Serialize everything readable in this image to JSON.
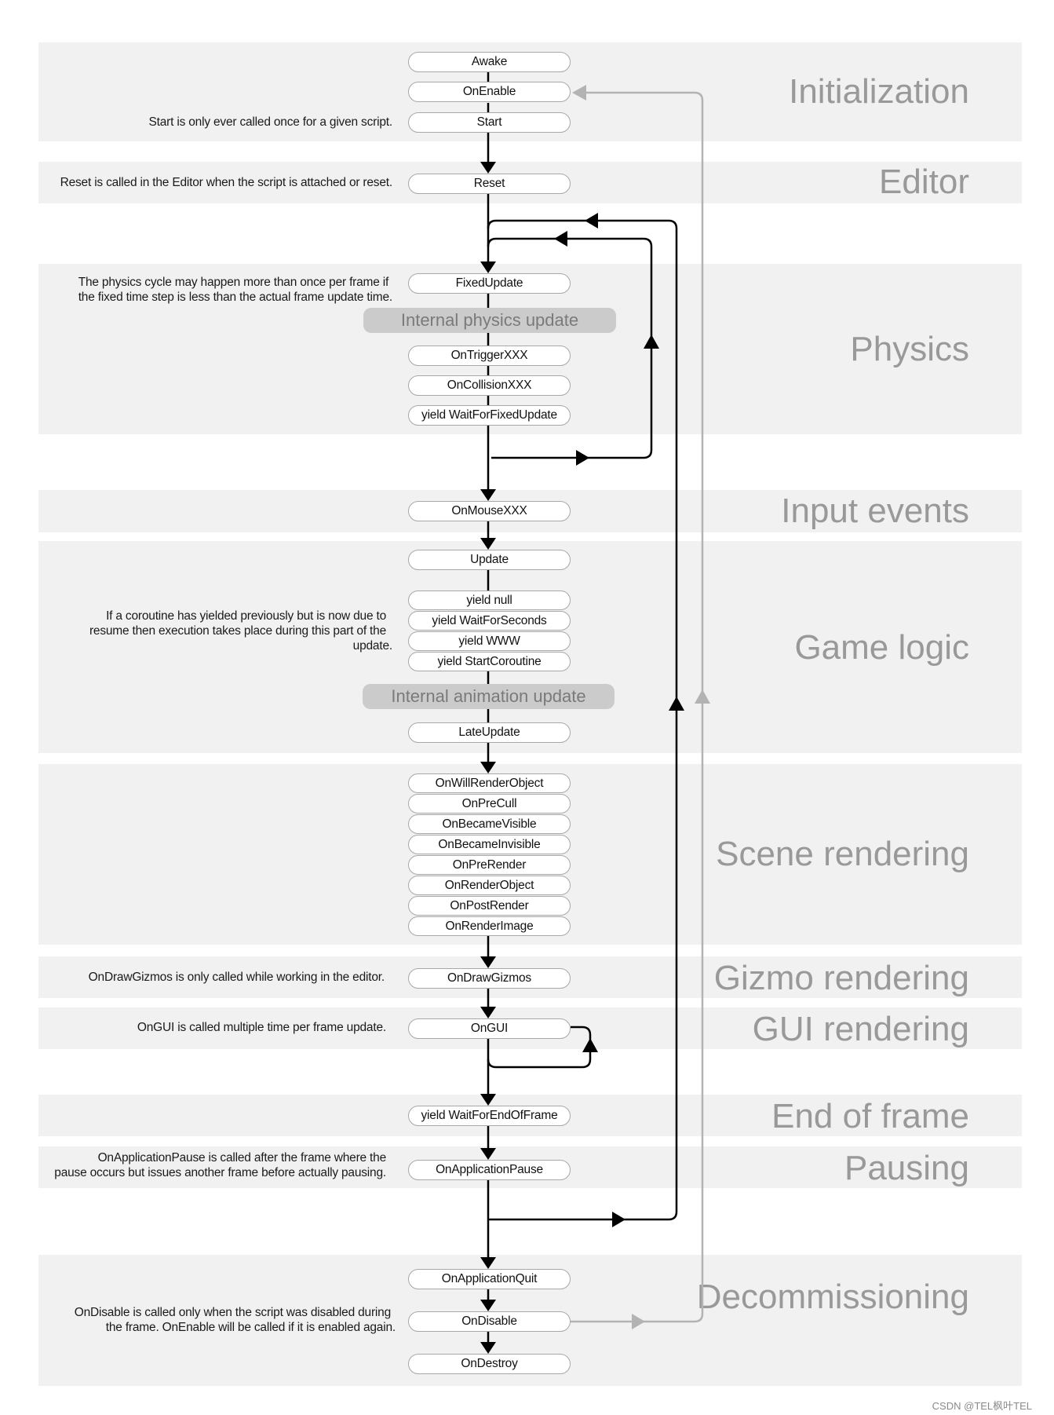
{
  "bands": [
    {
      "id": "initialization",
      "label": "Initialization"
    },
    {
      "id": "editor",
      "label": "Editor"
    },
    {
      "id": "physics",
      "label": "Physics"
    },
    {
      "id": "input",
      "label": "Input events"
    },
    {
      "id": "game-logic",
      "label": "Game logic"
    },
    {
      "id": "scene-rendering",
      "label": "Scene rendering"
    },
    {
      "id": "gizmo-rendering",
      "label": "Gizmo rendering"
    },
    {
      "id": "gui-rendering",
      "label": "GUI rendering"
    },
    {
      "id": "end-of-frame",
      "label": "End of frame"
    },
    {
      "id": "pausing",
      "label": "Pausing"
    },
    {
      "id": "decommissioning",
      "label": "Decommissioning"
    }
  ],
  "nodes": {
    "awake": "Awake",
    "onenable": "OnEnable",
    "start": "Start",
    "reset": "Reset",
    "fixedupdate": "FixedUpdate",
    "ontrigger": "OnTriggerXXX",
    "oncollision": "OnCollisionXXX",
    "waitforfixedupdate": "yield WaitForFixedUpdate",
    "onmouse": "OnMouseXXX",
    "update": "Update",
    "yieldnull": "yield null",
    "waitforseconds": "yield WaitForSeconds",
    "yieldwww": "yield WWW",
    "startcoroutine": "yield StartCoroutine",
    "lateupdate": "LateUpdate",
    "onwillrenderobject": "OnWillRenderObject",
    "onprecull": "OnPreCull",
    "onbecamevisible": "OnBecameVisible",
    "onbecameinvisible": "OnBecameInvisible",
    "onprerender": "OnPreRender",
    "onrenderobject": "OnRenderObject",
    "onpostrender": "OnPostRender",
    "onrenderimage": "OnRenderImage",
    "ondrawgizmos": "OnDrawGizmos",
    "ongui": "OnGUI",
    "waitforendofframe": "yield WaitForEndOfFrame",
    "onapplicationpause": "OnApplicationPause",
    "onapplicationquit": "OnApplicationQuit",
    "ondisable": "OnDisable",
    "ondestroy": "OnDestroy"
  },
  "internal": {
    "physics": "Internal physics update",
    "animation": "Internal animation update"
  },
  "notes": {
    "start": "Start is only ever called once for a given script.",
    "reset": "Reset is called in the Editor when the script is attached or reset.",
    "physics_1": "The physics cycle may happen more than once per frame if",
    "physics_2": "the fixed time step is less than the actual frame update time.",
    "coroutine_1": "If a coroutine has yielded previously but is now due to",
    "coroutine_2": "resume then execution takes place during this part of the",
    "coroutine_3": "update.",
    "gizmos": "OnDrawGizmos is only called while working in the editor.",
    "gui": "OnGUI is called multiple time per frame update.",
    "pause_1": "OnApplicationPause is called after the frame where the",
    "pause_2": "pause occurs but issues another frame before actually pausing.",
    "disable_1": "OnDisable is called only when the script was disabled during",
    "disable_2": "the frame. OnEnable will be called if it is enabled again."
  },
  "colors": {
    "band": "#f1f1f1",
    "band_label": "#999999",
    "flow": "#000000",
    "reenable_flow": "#b3b3b3",
    "internal_pill": "#cbcbcb"
  },
  "watermark": "CSDN @TEL枫叶TEL"
}
